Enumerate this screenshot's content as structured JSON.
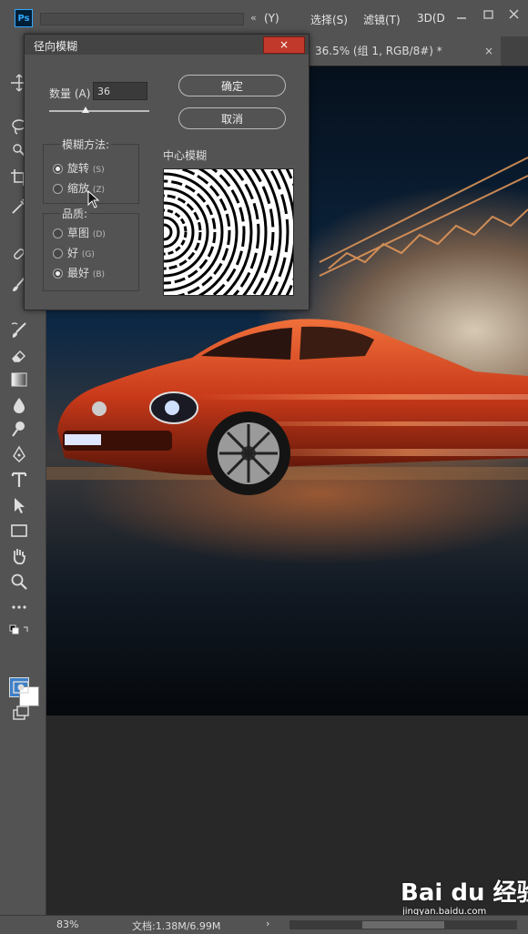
{
  "app": {
    "logo": "Ps"
  },
  "menubar": {
    "expand_icon": "«",
    "items": [
      "(Y)",
      "选择(S)",
      "滤镜(T)",
      "3D(D"
    ],
    "window_controls": [
      "minimize-icon",
      "restore-icon",
      "close-icon"
    ]
  },
  "document_tab": {
    "title": "36.5% (组 1, RGB/8#) *",
    "close_label": "×"
  },
  "dialog": {
    "title": "径向模糊",
    "close_label": "×",
    "amount": {
      "label": "数量 (A)",
      "value": "36",
      "slider_fraction": 0.36
    },
    "ok_button": "确定",
    "cancel_button": "取消",
    "blur_method": {
      "title": "模糊方法:",
      "options": [
        {
          "label": "旋转",
          "shortcut": "(S)",
          "selected": true
        },
        {
          "label": "缩放",
          "shortcut": "(Z)",
          "selected": false
        }
      ]
    },
    "quality": {
      "title": "品质:",
      "options": [
        {
          "label": "草图",
          "shortcut": "(D)",
          "selected": false
        },
        {
          "label": "好",
          "shortcut": "(G)",
          "selected": false
        },
        {
          "label": "最好",
          "shortcut": "(B)",
          "selected": true
        }
      ]
    },
    "center_label": "中心模糊"
  },
  "tools": [
    "move-icon",
    "lasso-icon",
    "quick-select-icon",
    "crop-icon",
    "eyedropper-icon",
    "healing-brush-icon",
    "brush-icon",
    "history-brush-icon",
    "eraser-icon",
    "gradient-icon",
    "blur-icon",
    "dodge-icon",
    "pen-icon",
    "type-icon",
    "path-select-icon",
    "rectangle-icon",
    "hand-icon",
    "zoom-icon",
    "more-tools-icon"
  ],
  "colors": {
    "foreground": "#3d7fc9",
    "background": "#ffffff",
    "dialog_close": "#c0392b"
  },
  "status": {
    "zoom": "83%",
    "doc_info": "文档:1.38M/6.99M",
    "arrow": "›"
  },
  "watermark": {
    "brand": "Bai du 经验",
    "url": "jingyan.baidu.com"
  }
}
